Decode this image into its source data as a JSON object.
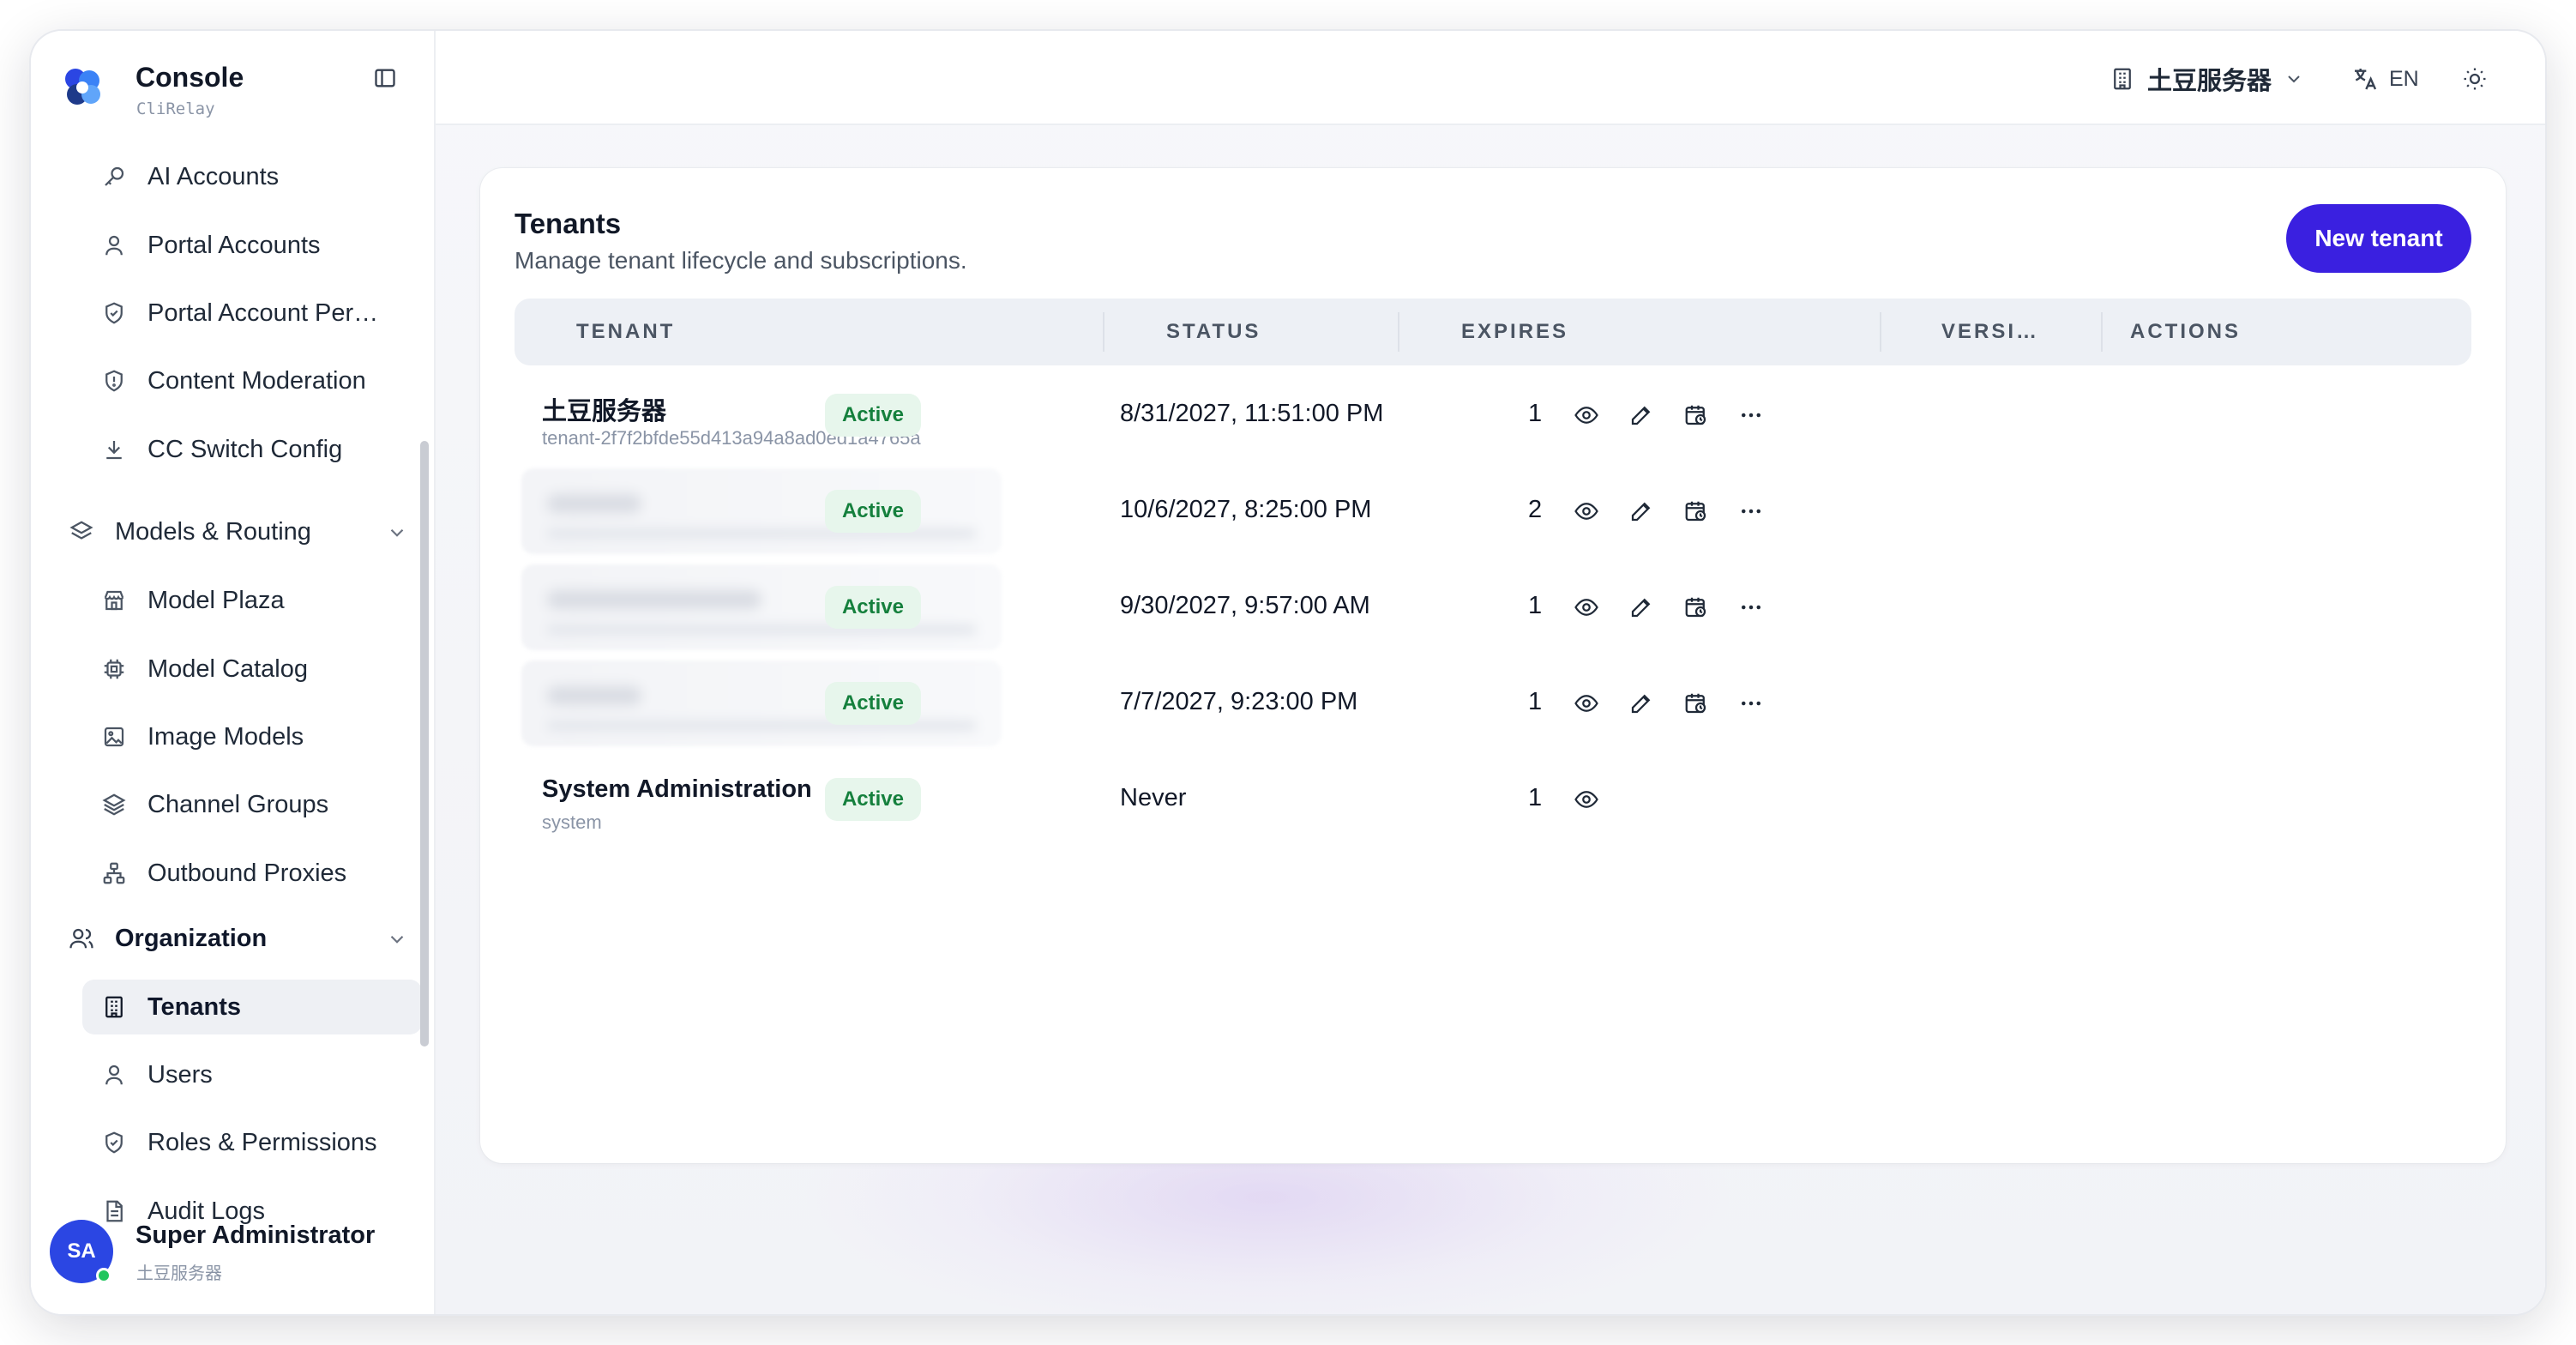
{
  "brand": {
    "title": "Console",
    "subtitle": "CliRelay"
  },
  "sidebar": {
    "items": [
      {
        "label": "AI Accounts",
        "icon": "key-icon"
      },
      {
        "label": "Portal Accounts",
        "icon": "user-icon"
      },
      {
        "label": "Portal Account Per…",
        "icon": "shield-check-icon"
      },
      {
        "label": "Content Moderation",
        "icon": "shield-alert-icon"
      },
      {
        "label": "CC Switch Config",
        "icon": "download-icon"
      }
    ],
    "group_models": {
      "label": "Models & Routing",
      "icon": "layers-icon"
    },
    "models_items": [
      {
        "label": "Model Plaza",
        "icon": "store-icon"
      },
      {
        "label": "Model Catalog",
        "icon": "chip-icon"
      },
      {
        "label": "Image Models",
        "icon": "image-icon"
      },
      {
        "label": "Channel Groups",
        "icon": "layers-icon"
      },
      {
        "label": "Outbound Proxies",
        "icon": "network-icon"
      }
    ],
    "group_org": {
      "label": "Organization",
      "icon": "users-icon"
    },
    "org_items": [
      {
        "label": "Tenants",
        "icon": "building-icon",
        "active": true
      },
      {
        "label": "Users",
        "icon": "user-icon"
      },
      {
        "label": "Roles & Permissions",
        "icon": "shield-check-icon"
      },
      {
        "label": "Audit Logs",
        "icon": "file-text-icon"
      }
    ]
  },
  "user": {
    "initials": "SA",
    "name": "Super Administrator",
    "tenant": "土豆服务器"
  },
  "topbar": {
    "tenant_name": "土豆服务器",
    "language": "EN"
  },
  "page": {
    "title": "Tenants",
    "subtitle": "Manage tenant lifecycle and subscriptions.",
    "new_button": "New tenant"
  },
  "table": {
    "headers": [
      "TENANT",
      "STATUS",
      "EXPIRES",
      "VERSI…",
      "ACTIONS"
    ],
    "rows": [
      {
        "name": "土豆服务器",
        "id": "tenant-2f7f2bfde55d413a94a8ad0ed1a4765a",
        "status": "Active",
        "expires": "8/31/2027, 11:51:00 PM",
        "version": "1",
        "blurred": false
      },
      {
        "name": "",
        "id": "",
        "status": "Active",
        "expires": "10/6/2027, 8:25:00 PM",
        "version": "2",
        "blurred": true
      },
      {
        "name": "",
        "id": "",
        "status": "Active",
        "expires": "9/30/2027, 9:57:00 AM",
        "version": "1",
        "blurred": true
      },
      {
        "name": "",
        "id": "",
        "status": "Active",
        "expires": "7/7/2027, 9:23:00 PM",
        "version": "1",
        "blurred": true
      },
      {
        "name": "System Administration",
        "id": "system",
        "status": "Active",
        "expires": "Never",
        "version": "1",
        "blurred": false
      }
    ]
  },
  "colors": {
    "accent": "#3a20e0",
    "active_badge_bg": "#e7f6ec",
    "active_badge_text": "#15803d",
    "avatar": "#2b46e3"
  }
}
